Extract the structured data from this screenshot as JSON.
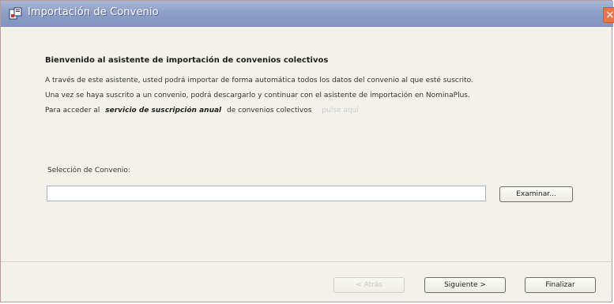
{
  "window": {
    "title": "Importación de Convenio",
    "close_glyph": "×",
    "title_bar_color": "#8ea0c8"
  },
  "welcome": {
    "heading": "Bienvenido al asistente de importación de convenios colectivos",
    "line1": "A través de este asistente, usted podrá importar de forma automática todos los datos del convenio al que esté suscrito.",
    "line2": "Una vez se haya suscrito a un convenio, podrá descargarlo y continuar con el asistente de importación en NominaPlus.",
    "line3_prefix": "Para acceder al",
    "line3_emphasis": "servicio de suscripción anual",
    "line3_suffix": "de convenios colectivos",
    "line3_link": "pulse aquí"
  },
  "selection": {
    "label": "Selección de Convenio:",
    "value": "",
    "browse_label": "Examinar..."
  },
  "footer": {
    "back_label": "< Atrás",
    "next_label": "Siguiente >",
    "finish_label": "Finalizar"
  }
}
